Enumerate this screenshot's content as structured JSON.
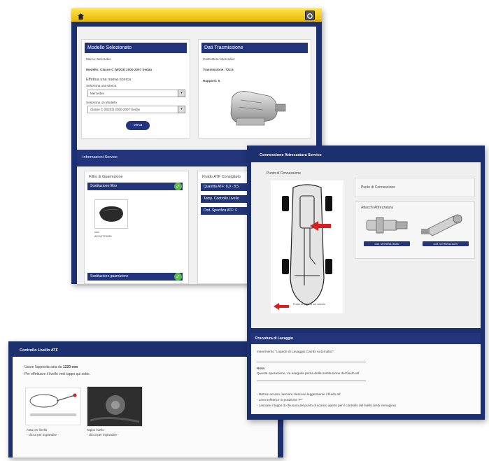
{
  "window_main": {
    "selected_model_panel": {
      "title": "Modello Selezionato",
      "brand_line": "Marca: Mercedes",
      "model_line": "Modello: Classe C (W203) 2000-2007 Sedan",
      "new_search": "Effettua una nuova ricerca",
      "brand_label": "Seleziona una Marca",
      "brand_value": "Mercedes",
      "model_label": "Seleziona un Modello",
      "model_value": "Classe C (W203) 2000-2007 Sedan",
      "search_button": "cerca"
    },
    "transmission_panel": {
      "title": "Dati Trasmissione",
      "maker_line": "Costruttore: Mercedes",
      "transmission_line": "Trasmissione: 722.6",
      "ratios_line": "Rapporti: 5"
    },
    "service_info": {
      "title": "Informazioni Service",
      "filters_title": "Filtro & Guarnizione",
      "filter_replace": "Sostituzione filtro",
      "filter_code_label": "cod.",
      "filter_code": "A2112770095",
      "gasket_replace": "Sostituzione guarnizione",
      "atf_title": "Fluido ATF Consigliato",
      "atf_rows": [
        "Quantità ATF: 8,0 - 8,5",
        "Temp. Controllo Livello",
        "Cod. Specifica ATF: F"
      ]
    }
  },
  "window_connection": {
    "title": "Connessione Attrezzatura Service",
    "connection_point_title": "Punto di Connessione",
    "connection_point_label": "Punto di Connessione",
    "car_caption": "Punto di attacco sul veicolo",
    "adapters_title": "Attacchi Attrezzatura",
    "adapter_codes": [
      "cod. 007905115160",
      "cod. 007905115170"
    ],
    "procedure_title": "Procedura di Lavaggio",
    "procedure_intro": "Inserimento \"Liquido di Lavaggio Cambi Automatici\":",
    "note_label": "Nota:",
    "note_text": "Questa operazione, va eseguita prima della sostituzione del fluido atf",
    "steps": [
      "- Motore acceso, lasciare ciascuna leggermente il fluido atf",
      "- Leva selettrice in posizione \"P\"",
      "- Lasciare il tappo di chiusura del punto di scarico aperto per il controllo del livello (vedi immagine)"
    ]
  },
  "window_level": {
    "title": "Controllo Livello ATF",
    "line1_prefix": "- Usare l'apposita asta da",
    "line1_value": "1220 mm",
    "line2": "- Per effettuare il livello vedi tappo qui sotto.",
    "dipstick_caption": "Asta per livello",
    "dipstick_sub": "- clicca per ingrandire -",
    "plug_caption": "Tappo livello",
    "plug_sub": "- clicca per ingrandire -"
  },
  "colors": {
    "navy": "#1c2f6e",
    "header_yellow": "#f5c800",
    "check_green": "#5cbb44",
    "arrow_red": "#d42020"
  }
}
